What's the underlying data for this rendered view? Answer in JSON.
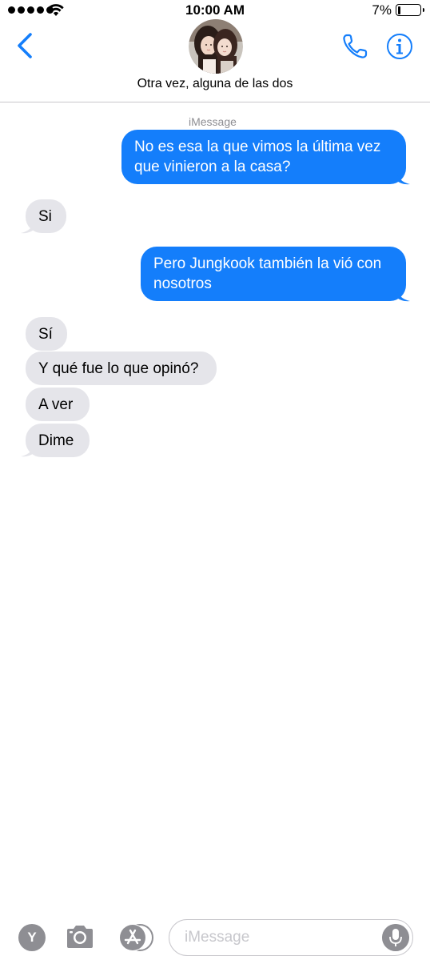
{
  "status_bar": {
    "time": "10:00 AM",
    "battery_percent": "7%",
    "battery_level": 0.07
  },
  "header": {
    "contact_name": "Otra vez, alguna de las dos"
  },
  "conversation": {
    "service_label": "iMessage",
    "messages": [
      {
        "direction": "outgoing",
        "text_line1": "No es esa la que vimos la última vez",
        "text_line2": "que vinieron a la casa?"
      },
      {
        "direction": "incoming",
        "text": "Si"
      },
      {
        "direction": "outgoing",
        "text_line1": "Pero Jungkook también la vió con",
        "text_line2": "nosotros"
      },
      {
        "direction": "incoming",
        "text": "Sí"
      },
      {
        "direction": "incoming",
        "text": "Y qué fue lo que opinó?"
      },
      {
        "direction": "incoming",
        "text": "A ver"
      },
      {
        "direction": "incoming",
        "text": "Dime"
      }
    ]
  },
  "input_bar": {
    "app_drawer_label": "Y",
    "placeholder": "iMessage"
  },
  "colors": {
    "outgoing_bubble": "#147efb",
    "incoming_bubble": "#e5e5ea",
    "accent": "#147efb",
    "secondary_text": "#8e8e93"
  },
  "icons": [
    "back-chevron-icon",
    "phone-icon",
    "info-icon",
    "camera-icon",
    "app-store-icon",
    "microphone-icon",
    "wifi-icon",
    "signal-icon",
    "battery-icon"
  ]
}
